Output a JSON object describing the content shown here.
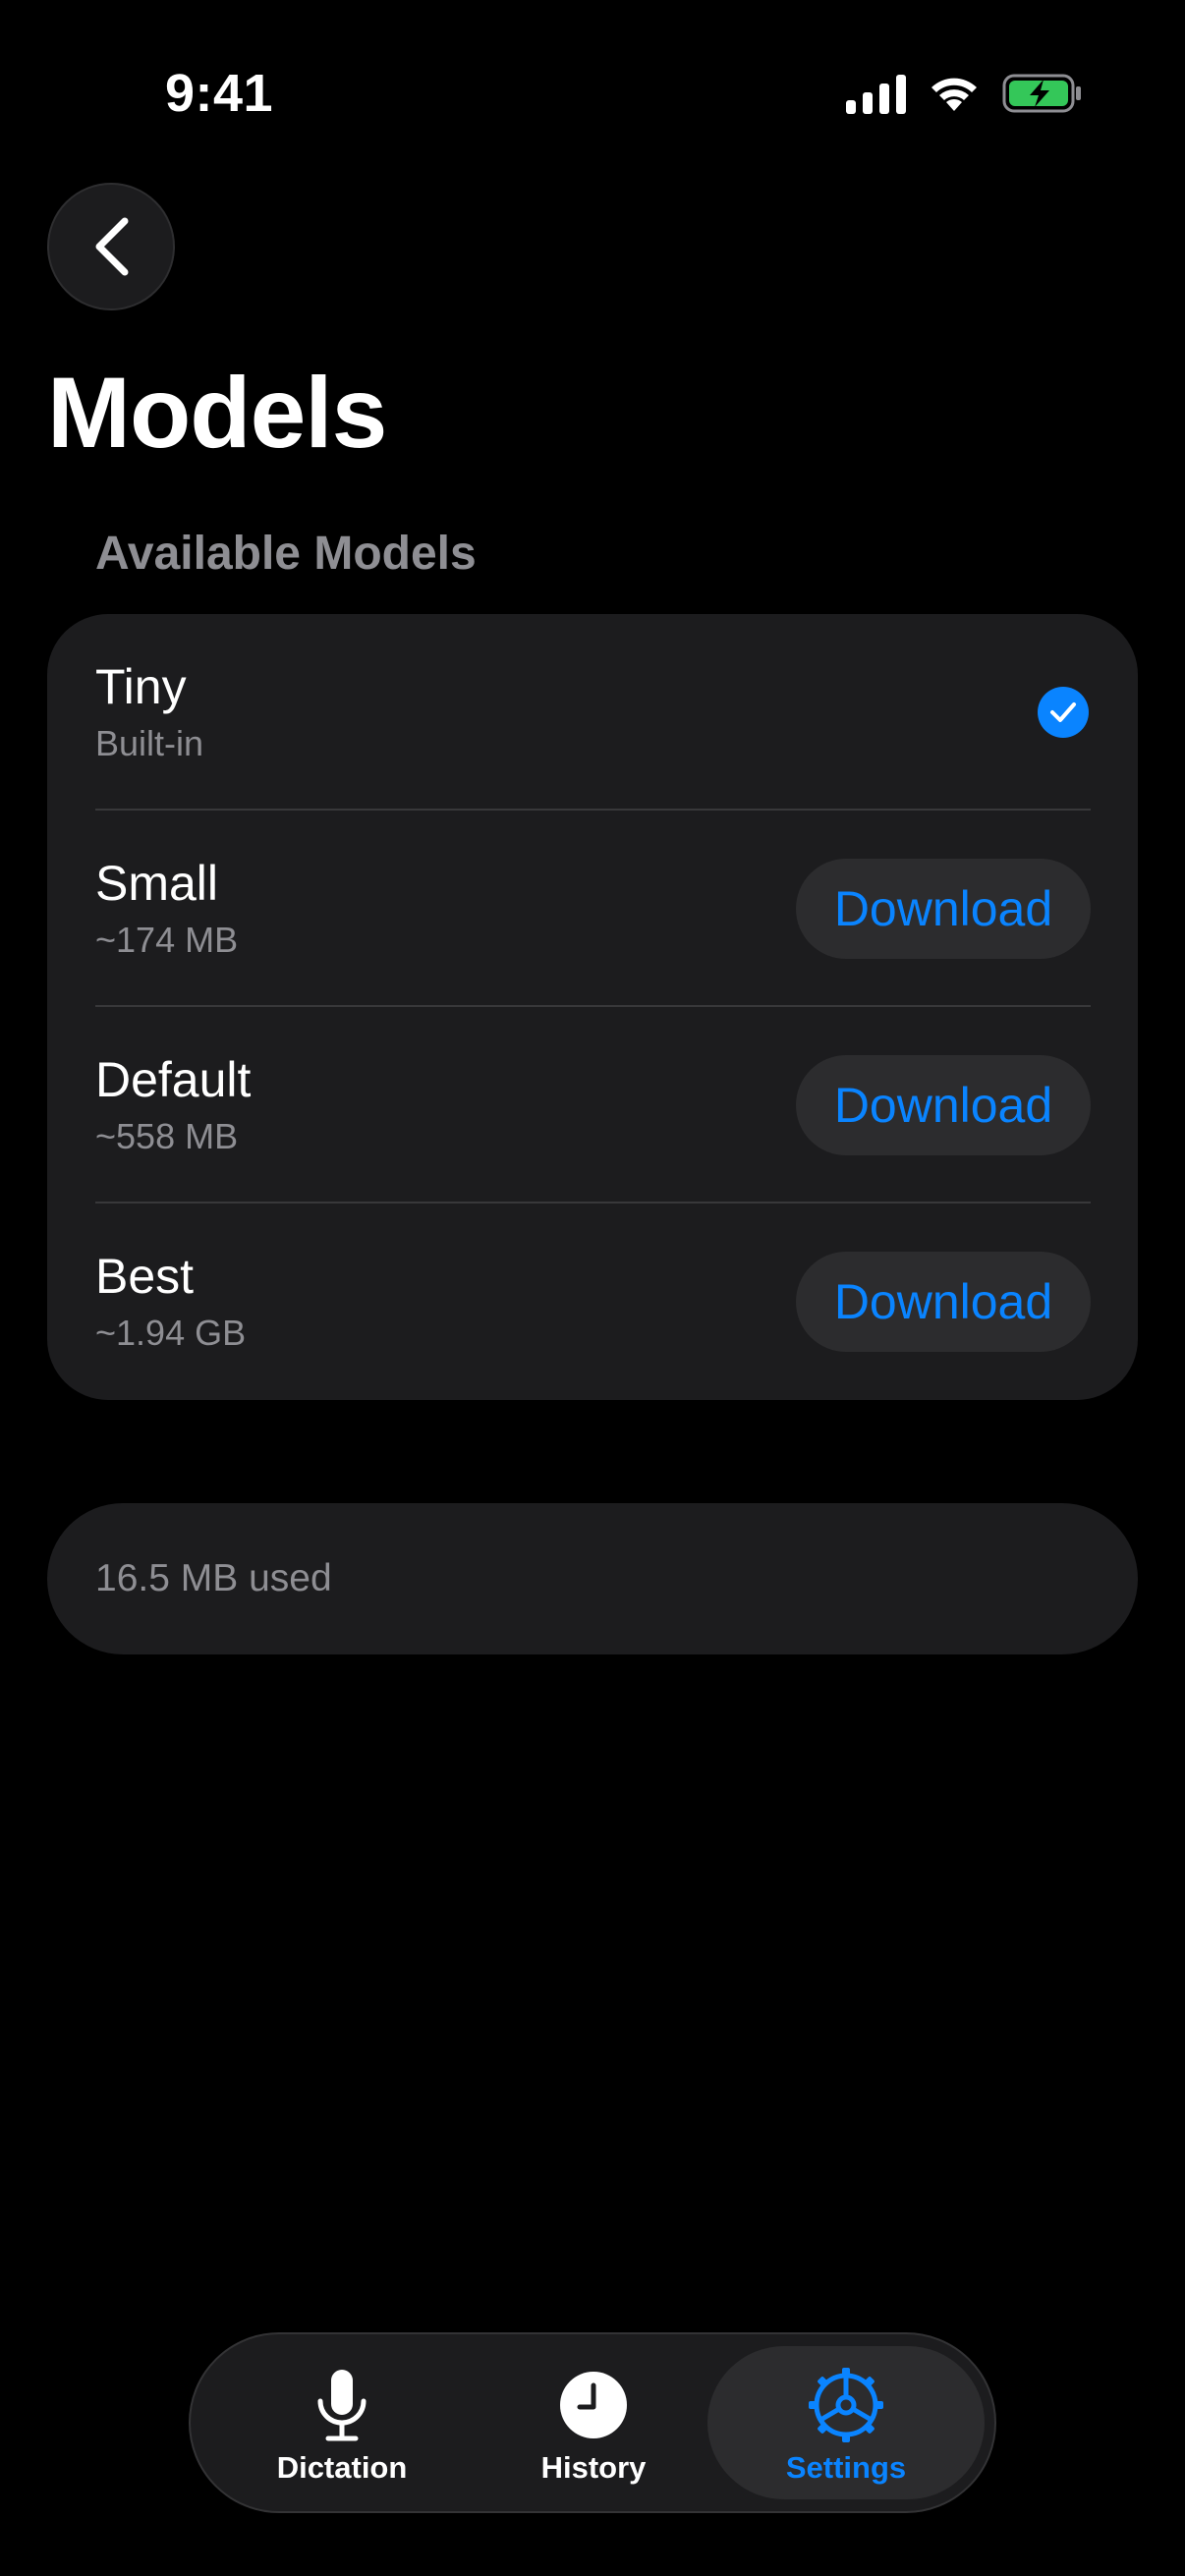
{
  "status_bar": {
    "time": "9:41"
  },
  "header": {
    "back_icon": "chevron-left-icon",
    "title": "Models"
  },
  "section": {
    "header": "Available Models"
  },
  "models": [
    {
      "name": "Tiny",
      "detail": "Built-in",
      "state": "selected"
    },
    {
      "name": "Small",
      "detail": "~174 MB",
      "action": "Download"
    },
    {
      "name": "Default",
      "detail": "~558 MB",
      "action": "Download"
    },
    {
      "name": "Best",
      "detail": "~1.94 GB",
      "action": "Download"
    }
  ],
  "storage": {
    "text": "16.5 MB used"
  },
  "tabs": [
    {
      "label": "Dictation",
      "icon": "microphone-icon",
      "active": false
    },
    {
      "label": "History",
      "icon": "clock-icon",
      "active": false
    },
    {
      "label": "Settings",
      "icon": "gear-icon",
      "active": true
    }
  ],
  "colors": {
    "background": "#000000",
    "card": "#1c1c1e",
    "accent": "#0a84ff",
    "secondary_text": "#8e8e93",
    "battery": "#34c759"
  }
}
